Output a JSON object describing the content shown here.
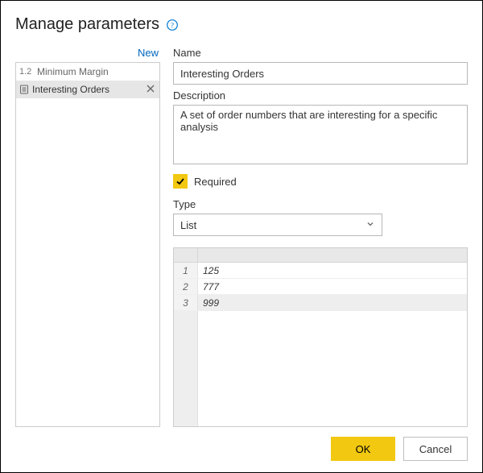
{
  "dialog": {
    "title": "Manage parameters",
    "new_link": "New"
  },
  "params": [
    {
      "prefix": "1.2",
      "label": "Minimum Margin",
      "selected": false
    },
    {
      "prefix": "",
      "label": "Interesting Orders",
      "selected": true
    }
  ],
  "form": {
    "name_label": "Name",
    "name_value": "Interesting Orders",
    "desc_label": "Description",
    "desc_value": "A set of order numbers that are interesting for a specific analysis",
    "required_label": "Required",
    "required_checked": true,
    "type_label": "Type",
    "type_value": "List"
  },
  "list_values": [
    "125",
    "777",
    "999"
  ],
  "buttons": {
    "ok": "OK",
    "cancel": "Cancel"
  }
}
